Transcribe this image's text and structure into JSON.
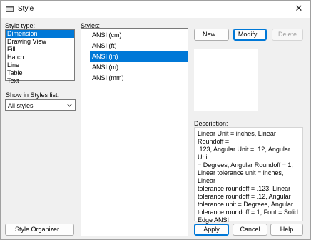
{
  "window": {
    "title": "Style",
    "close_glyph": "✕",
    "icon": "style-app-icon"
  },
  "style_type": {
    "label": "Style type:",
    "items": [
      "Dimension",
      "Drawing View",
      "Fill",
      "Hatch",
      "Line",
      "Table",
      "Text"
    ],
    "selected": "Dimension"
  },
  "styles": {
    "label": "Styles:",
    "items": [
      "ANSI (cm)",
      "ANSI (ft)",
      "ANSI (in)",
      "ANSI (m)",
      "ANSI (mm)"
    ],
    "selected": "ANSI (in)"
  },
  "show_in_list": {
    "label": "Show in Styles list:",
    "value": "All styles"
  },
  "buttons": {
    "new": "New...",
    "modify": "Modify...",
    "delete": "Delete",
    "style_organizer": "Style Organizer...",
    "apply": "Apply",
    "cancel": "Cancel",
    "help": "Help"
  },
  "description": {
    "label": "Description:",
    "lines": [
      "Linear Unit = inches, Linear Roundoff =",
      ".123, Angular Unit = .12, Angular Unit",
      "= Degrees, Angular Roundoff = 1,",
      "Linear tolerance unit = inches, Linear",
      "tolerance roundoff = .123, Linear",
      "tolerance roundoff = .12, Angular",
      "tolerance unit = Degrees, Angular",
      "tolerance roundoff = 1, Font = Solid",
      "Edge ANSI"
    ]
  },
  "colors": {
    "selection": "#0078d7",
    "dialog_bg": "#f0f0f0"
  }
}
